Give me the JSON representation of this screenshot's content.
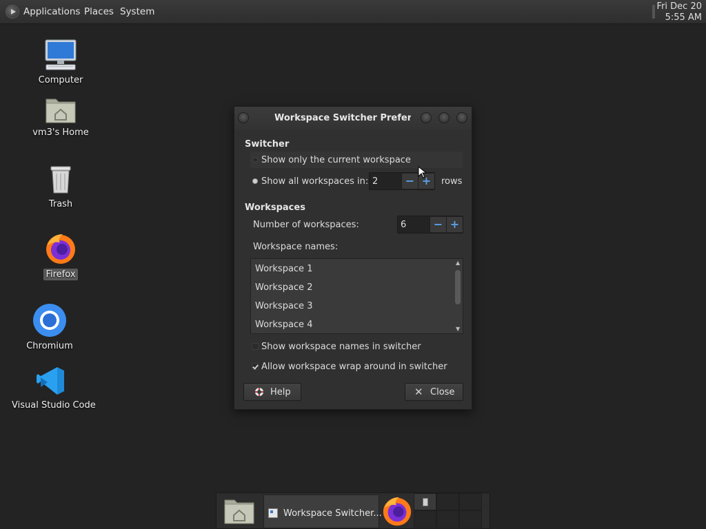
{
  "top_panel": {
    "menus": [
      "Applications",
      "Places",
      "System"
    ],
    "clock": {
      "date": "Fri Dec 20",
      "time": "5:55 AM"
    }
  },
  "desktop": {
    "icons": [
      {
        "label": "Computer",
        "icon": "computer-icon"
      },
      {
        "label": "vm3's Home",
        "icon": "home-folder-icon"
      },
      {
        "label": "Trash",
        "icon": "trash-icon"
      },
      {
        "label": "Firefox",
        "icon": "firefox-icon"
      },
      {
        "label": "Chromium",
        "icon": "chromium-icon"
      },
      {
        "label": "Visual Studio Code",
        "icon": "vscode-icon"
      }
    ]
  },
  "dialog": {
    "title": "Workspace Switcher Preferences",
    "switcher_section": "Switcher",
    "show_current_label": "Show only the current workspace",
    "show_all_label": "Show all workspaces in:",
    "rows_value": "2",
    "rows_suffix": "rows",
    "workspaces_section": "Workspaces",
    "num_workspaces_label": "Number of workspaces:",
    "num_workspaces_value": "6",
    "names_label": "Workspace names:",
    "workspace_names": [
      "Workspace 1",
      "Workspace 2",
      "Workspace 3",
      "Workspace 4"
    ],
    "show_names_label": "Show workspace names in switcher",
    "show_names_checked": false,
    "wrap_label": "Allow workspace wrap around in switcher",
    "wrap_checked": true,
    "help_label": "Help",
    "close_label": "Close",
    "spin_minus": "−",
    "spin_plus": "+"
  },
  "bottom_panel": {
    "task_label": "Workspace Switcher..."
  },
  "colors": {
    "desktop_bg": "#232323",
    "dialog_bg": "#303030",
    "accent_blue": "#5aa0e8"
  }
}
